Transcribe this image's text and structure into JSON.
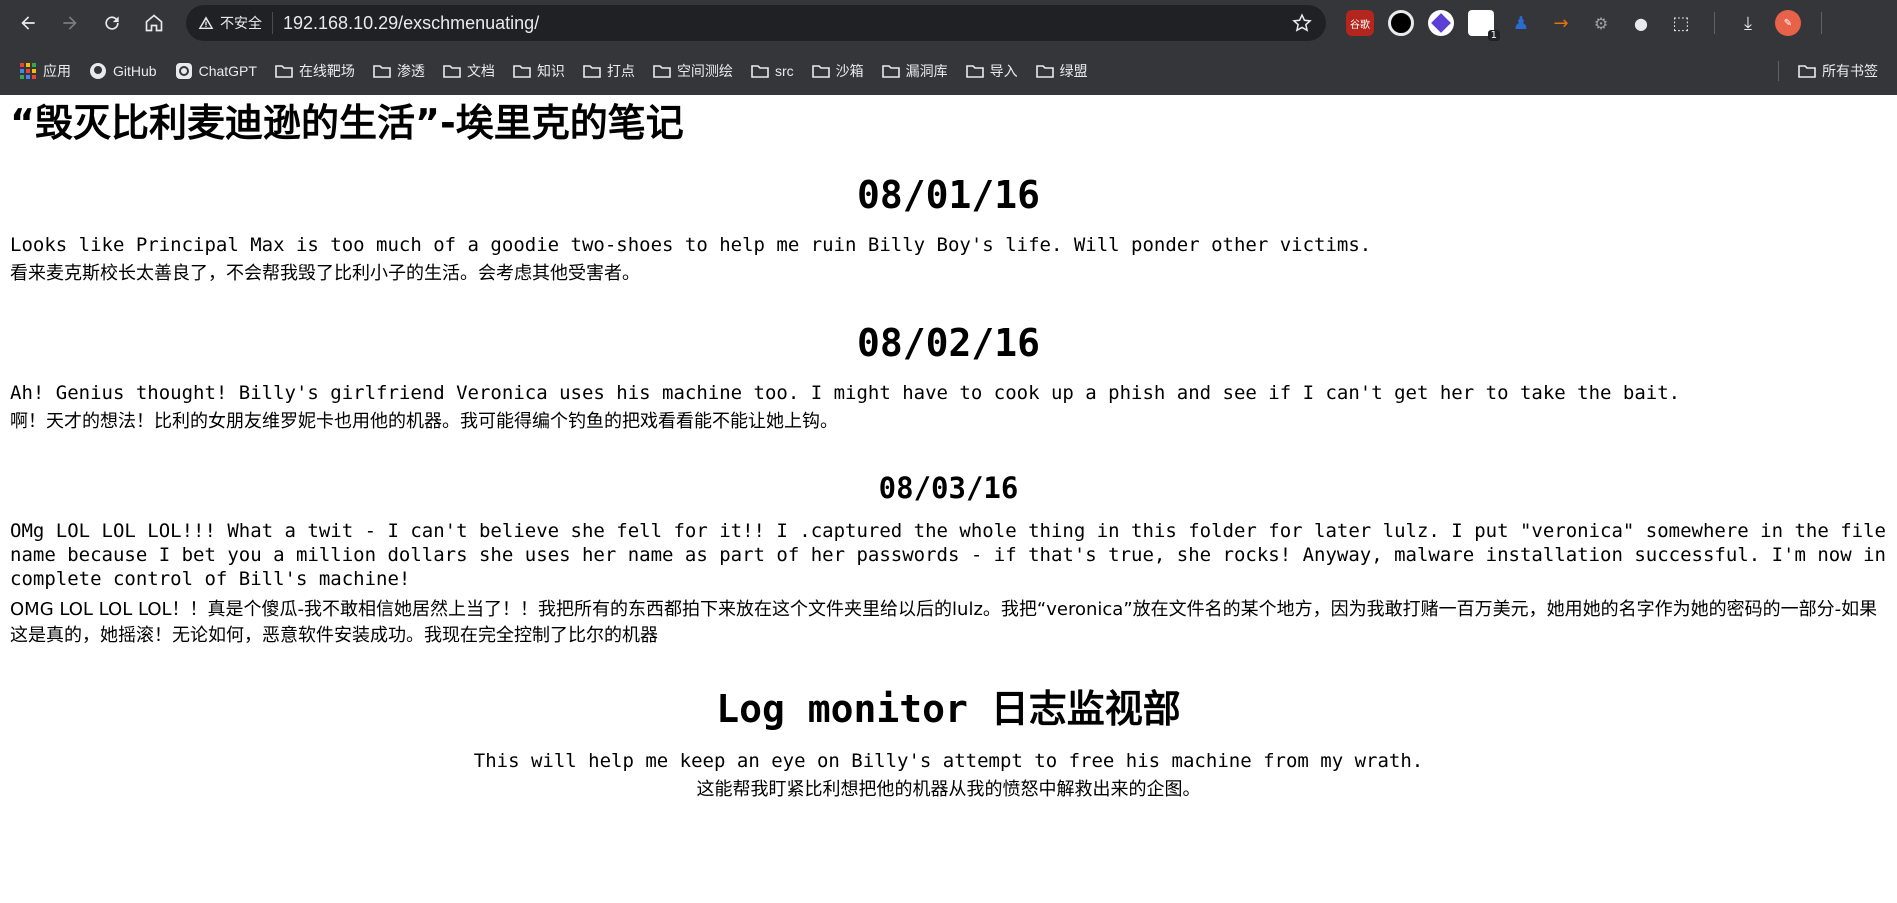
{
  "browser": {
    "security_label": "不安全",
    "url": "192.168.10.29/exschmenuating/",
    "extensions": [
      {
        "name": "谷歌",
        "color": "#b3261e"
      },
      {
        "name": "",
        "color": "#000000"
      },
      {
        "name": "",
        "color": "#5b3fd6"
      },
      {
        "name": "",
        "color": "#ffffff",
        "badge": "1"
      },
      {
        "name": "",
        "color": "#2a6bd1"
      },
      {
        "name": "",
        "color": "#e8710a"
      },
      {
        "name": "",
        "color": "#9aa0a6"
      },
      {
        "name": "",
        "color": "#e8eaed"
      },
      {
        "name": "",
        "color": "#e8eaed"
      }
    ],
    "bookmarks": [
      {
        "label": "应用",
        "icon": "apps-grid-icon"
      },
      {
        "label": "GitHub",
        "icon": "github-icon"
      },
      {
        "label": "ChatGPT",
        "icon": "chatgpt-icon"
      },
      {
        "label": "在线靶场",
        "icon": "folder-icon"
      },
      {
        "label": "渗透",
        "icon": "folder-icon"
      },
      {
        "label": "文档",
        "icon": "folder-icon"
      },
      {
        "label": "知识",
        "icon": "folder-icon"
      },
      {
        "label": "打点",
        "icon": "folder-icon"
      },
      {
        "label": "空间测绘",
        "icon": "folder-icon"
      },
      {
        "label": "src",
        "icon": "folder-icon"
      },
      {
        "label": "沙箱",
        "icon": "folder-icon"
      },
      {
        "label": "漏洞库",
        "icon": "folder-icon"
      },
      {
        "label": "导入",
        "icon": "folder-icon"
      },
      {
        "label": "绿盟",
        "icon": "folder-icon"
      }
    ],
    "all_bookmarks_label": "所有书签"
  },
  "page": {
    "title": "“毁灭比利麦迪逊的生活”-埃里克的笔记",
    "entries": [
      {
        "date": "08/01/16",
        "en": "Looks like Principal Max is too much of a goodie two-shoes to help me ruin Billy Boy's life. Will ponder other victims.",
        "cn": "看来麦克斯校长太善良了，不会帮我毁了比利小子的生活。会考虑其他受害者。"
      },
      {
        "date": "08/02/16",
        "en": "Ah! Genius thought! Billy's girlfriend Veronica uses his machine too. I might have to cook up a phish and see if I can't get her to take the bait.",
        "cn": "啊！天才的想法！比利的女朋友维罗妮卡也用他的机器。我可能得编个钓鱼的把戏看看能不能让她上钩。"
      },
      {
        "date": "08/03/16",
        "en": "OMg LOL LOL LOL!!! What a twit - I can't believe she fell for it!! I .captured the whole thing in this folder for later lulz. I put \"veronica\" somewhere in the file name because I bet you a million dollars she uses her name as part of her passwords - if that's true, she rocks! Anyway, malware installation successful. I'm now in complete control of Bill's machine!",
        "cn": "OMG LOL LOL LOL！！真是个傻瓜-我不敢相信她居然上当了！！我把所有的东西都拍下来放在这个文件夹里给以后的lulz。我把“veronica”放在文件名的某个地方，因为我敢打赌一百万美元，她用她的名字作为她的密码的一部分-如果这是真的，她摇滚！无论如何，恶意软件安装成功。我现在完全控制了比尔的机器"
      }
    ],
    "log_monitor": {
      "title": "Log monitor 日志监视部",
      "en": "This will help me keep an eye on Billy's attempt to free his machine from my wrath.",
      "cn": "这能帮我盯紧比利想把他的机器从我的愤怒中解救出来的企图。"
    }
  }
}
